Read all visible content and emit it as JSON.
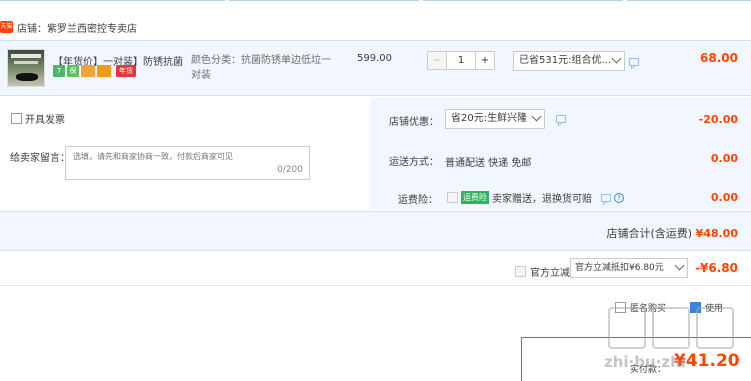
{
  "store": {
    "tag": "天猫",
    "name": "店铺：紫罗兰西密控专卖店"
  },
  "item": {
    "title": "【年货价】一对装】防锈抗菌 ...",
    "badges": [
      "7",
      "保",
      "",
      "",
      "年货"
    ],
    "sku": "颜色分类：抗菌防锈单边低垃一对装",
    "unit_price": "599.00",
    "quantity": "1",
    "coupon": "已省531元:组合优...",
    "total": "68.00"
  },
  "invoice": {
    "label": "开具发票"
  },
  "message": {
    "label": "给卖家留言：",
    "placeholder": "选填，请先和商家协商一致，付款后商家可见",
    "count": "0/200"
  },
  "shop_discount": {
    "label": "店铺优惠：",
    "value": "省20元:生鲜兴隆",
    "amount": "-20.00"
  },
  "shipping": {
    "label": "运送方式：",
    "value": "普通配送 快递 免邮",
    "amount": "0.00"
  },
  "insurance": {
    "label": "运费险：",
    "badge": "运费险",
    "text": "卖家赠送，退换货可赔",
    "amount": "0.00"
  },
  "subtotal": {
    "label": "店铺合计(含运费)",
    "amount": "¥48.00"
  },
  "offer": {
    "label": "官方立减",
    "value": "官方立减抵扣¥6.80元",
    "amount": "-¥6.80"
  },
  "bottom": {
    "anon_label": "匿名购买",
    "use_label": "使用"
  },
  "payment": {
    "label": "实付款：",
    "amount": "¥41.20"
  },
  "watermark": {
    "text": "zhi·bu·zhi"
  }
}
